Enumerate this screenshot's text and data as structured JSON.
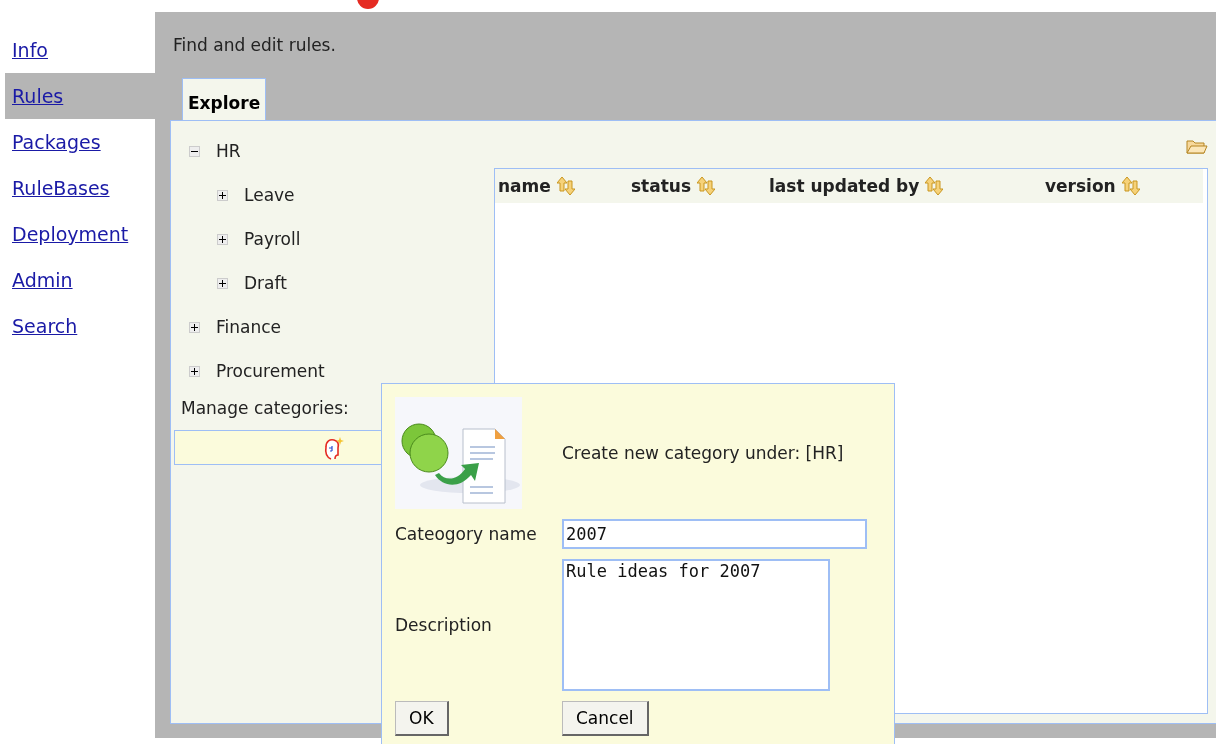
{
  "nav": [
    {
      "label": "Info",
      "selected": false
    },
    {
      "label": "Rules",
      "selected": true
    },
    {
      "label": "Packages",
      "selected": false
    },
    {
      "label": "RuleBases",
      "selected": false
    },
    {
      "label": "Deployment",
      "selected": false
    },
    {
      "label": "Admin",
      "selected": false
    },
    {
      "label": "Search",
      "selected": false
    }
  ],
  "header": "Find and edit rules.",
  "tabs": [
    {
      "label": "Explore",
      "selected": true
    }
  ],
  "tree": [
    {
      "label": "HR",
      "expanded": true,
      "children": [
        {
          "label": "Leave",
          "expanded": false
        },
        {
          "label": "Payroll",
          "expanded": false
        },
        {
          "label": "Draft",
          "expanded": false
        }
      ]
    },
    {
      "label": "Finance",
      "expanded": false
    },
    {
      "label": "Procurement",
      "expanded": false
    }
  ],
  "manage_categories": {
    "label": "Manage categories:"
  },
  "table": {
    "columns": [
      "name",
      "status",
      "last updated by",
      "version"
    ]
  },
  "dialog": {
    "title": "Create new category under: [HR]",
    "fields": [
      {
        "label": "Cateogory name",
        "kind": "input",
        "value": "2007"
      },
      {
        "label": "Description",
        "kind": "textarea",
        "value": "Rule ideas for 2007"
      }
    ],
    "buttons": [
      "OK",
      "Cancel"
    ]
  }
}
